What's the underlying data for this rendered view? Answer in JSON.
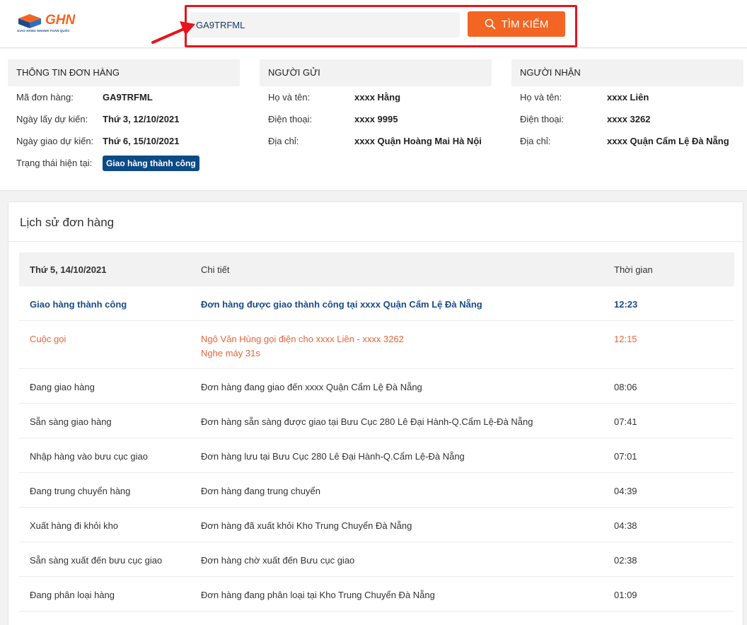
{
  "logo": {
    "brand": "GHN",
    "tagline": "GIAO HÀNG NHANH TOÀN QUỐC"
  },
  "search": {
    "value": "GA9TRFML",
    "button_label": "TÌM KIẾM"
  },
  "colors": {
    "accent": "#f26522",
    "brand_blue": "#1a4b8c",
    "status_badge": "#0d4a86",
    "highlight": "#e8141c"
  },
  "order_info": {
    "header": "THÔNG TIN ĐƠN HÀNG",
    "rows": [
      {
        "label": "Mã đơn hàng:",
        "value": "GA9TRFML"
      },
      {
        "label": "Ngày lấy dự kiến:",
        "value": "Thứ 3, 12/10/2021"
      },
      {
        "label": "Ngày giao dự kiến:",
        "value": "Thứ 6, 15/10/2021"
      }
    ],
    "status_label": "Trạng thái hiện tại:",
    "status_value": "Giao hàng thành công"
  },
  "sender": {
    "header": "NGƯỜI GỬI",
    "rows": [
      {
        "label": "Họ và tên:",
        "value": "xxxx Hằng"
      },
      {
        "label": "Điện thoại:",
        "value": "xxxx 9995"
      },
      {
        "label": "Địa chỉ:",
        "value": "xxxx Quận Hoàng Mai Hà Nội"
      }
    ]
  },
  "receiver": {
    "header": "NGƯỜI NHẬN",
    "rows": [
      {
        "label": "Họ và tên:",
        "value": "xxxx Liên"
      },
      {
        "label": "Điện thoại:",
        "value": "xxxx 3262"
      },
      {
        "label": "Địa chỉ:",
        "value": "xxxx Quận Cẩm Lệ Đà Nẵng"
      }
    ]
  },
  "history": {
    "title": "Lịch sử đơn hàng",
    "columns": {
      "date": "Thứ 5, 14/10/2021",
      "detail": "Chi tiết",
      "time": "Thời gian"
    },
    "rows": [
      {
        "status": "Giao hàng thành công",
        "detail": "Đơn hàng được giao thành công tại xxxx Quận Cẩm Lệ Đà Nẵng",
        "detail2": "",
        "time": "12:23"
      },
      {
        "status": "Cuộc gọi",
        "detail": "Ngô Văn Hùng gọi điện cho xxxx Liên - xxxx 3262",
        "detail2": "Nghe máy 31s",
        "time": "12:15"
      },
      {
        "status": "Đang giao hàng",
        "detail": "Đơn hàng đang giao đến xxxx Quận Cẩm Lệ Đà Nẵng",
        "detail2": "",
        "time": "08:06"
      },
      {
        "status": "Sẵn sàng giao hàng",
        "detail": "Đơn hàng sẵn sàng được giao tại Bưu Cục 280 Lê Đại Hành-Q.Cẩm Lệ-Đà Nẵng",
        "detail2": "",
        "time": "07:41"
      },
      {
        "status": "Nhập hàng vào bưu cục giao",
        "detail": "Đơn hàng lưu tại Bưu Cục 280 Lê Đại Hành-Q.Cẩm Lệ-Đà Nẵng",
        "detail2": "",
        "time": "07:01"
      },
      {
        "status": "Đang trung chuyển hàng",
        "detail": "Đơn hàng đang trung chuyển",
        "detail2": "",
        "time": "04:39"
      },
      {
        "status": "Xuất hàng đi khỏi kho",
        "detail": "Đơn hàng đã xuất khỏi Kho Trung Chuyển Đà Nẵng",
        "detail2": "",
        "time": "04:38"
      },
      {
        "status": "Sẵn sàng xuất đến bưu cục giao",
        "detail": "Đơn hàng chờ xuất đến Bưu cục giao",
        "detail2": "",
        "time": "02:38"
      },
      {
        "status": "Đang phân loại hàng",
        "detail": "Đơn hàng đang phân loại tại Kho Trung Chuyển Đà Nẵng",
        "detail2": "",
        "time": "01:09"
      }
    ]
  }
}
